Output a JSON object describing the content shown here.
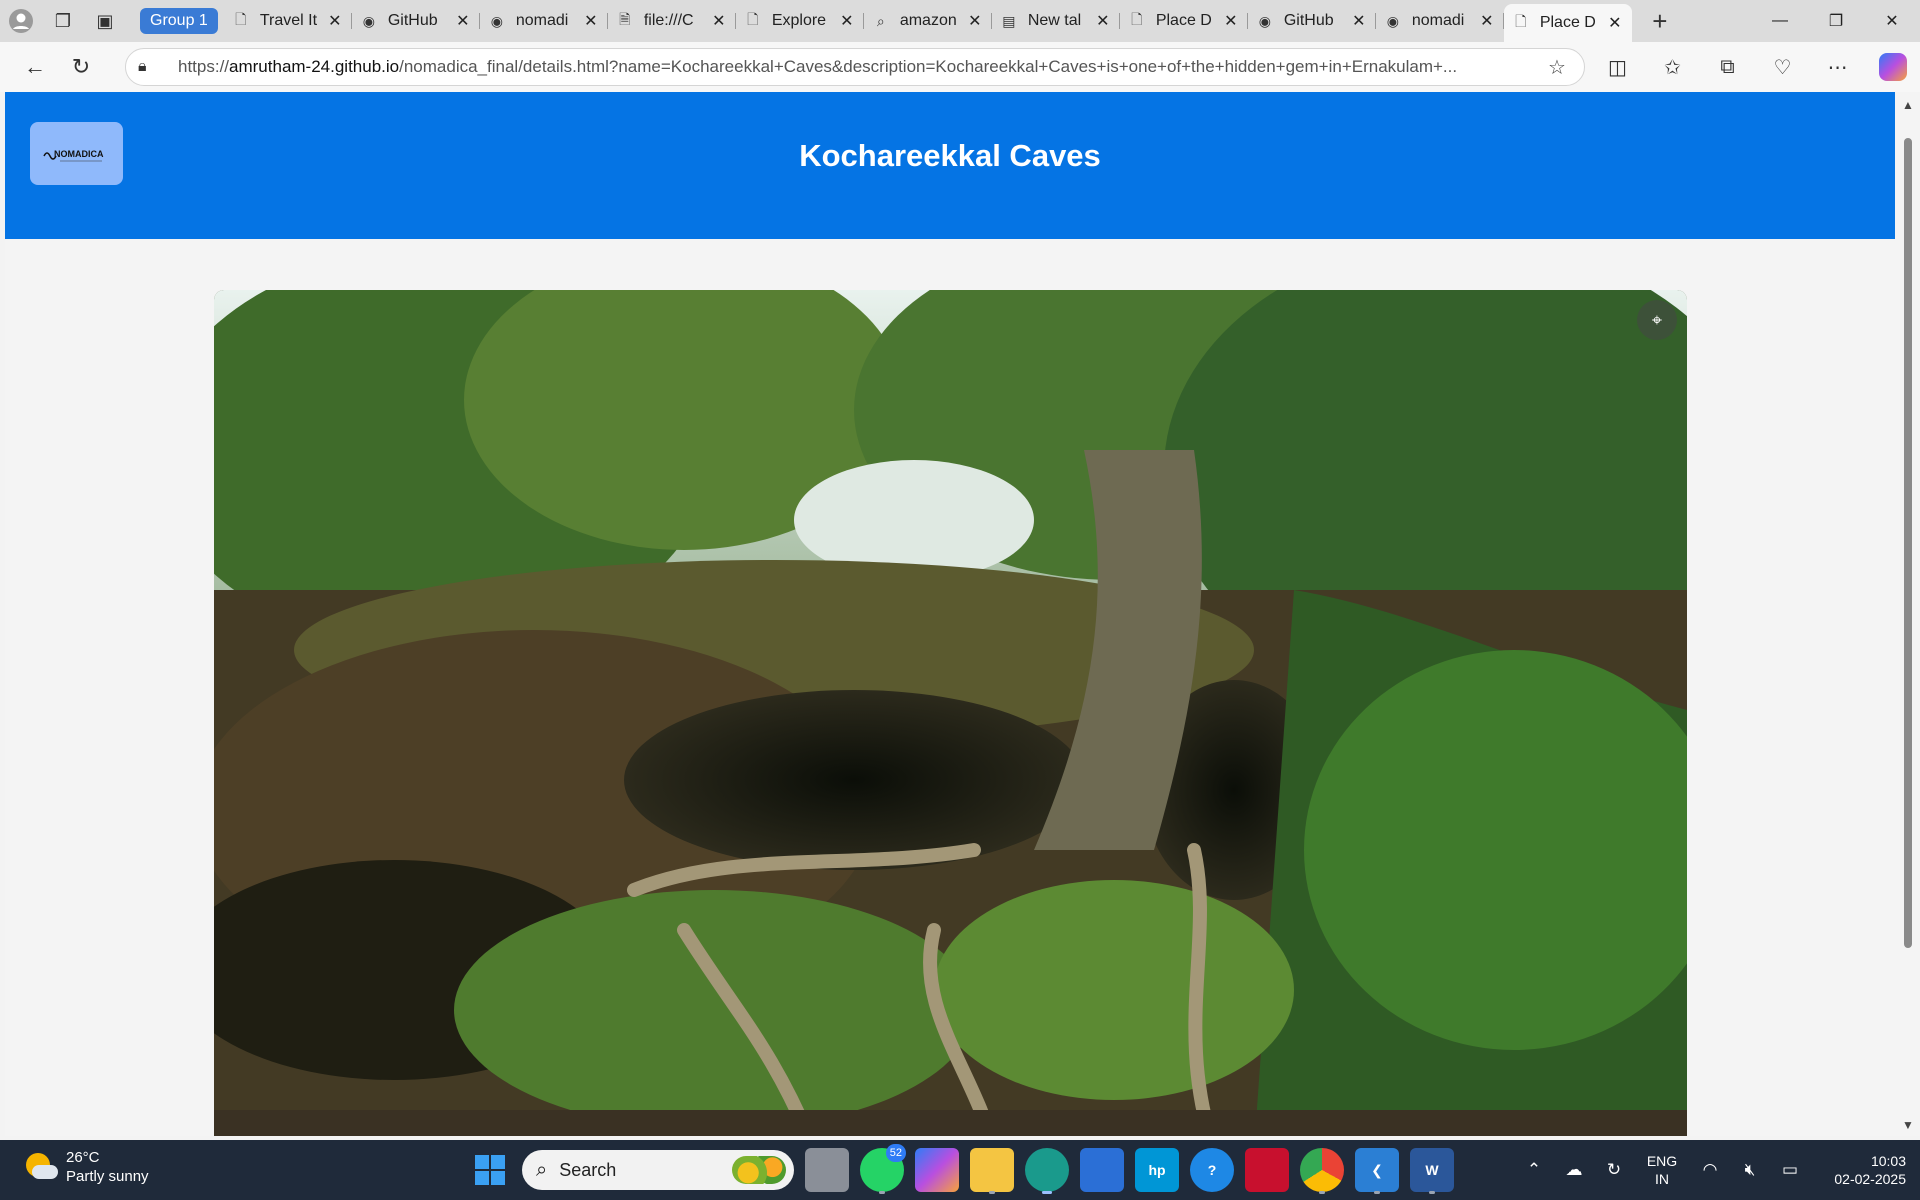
{
  "browser": {
    "group_label": "Group 1",
    "tabs": [
      {
        "title": "Travel It",
        "icon": "page-icon",
        "active": false
      },
      {
        "title": "GitHub",
        "icon": "github-icon",
        "active": false
      },
      {
        "title": "nomadi",
        "icon": "github-icon",
        "active": false
      },
      {
        "title": "file:///C",
        "icon": "file-icon",
        "active": false
      },
      {
        "title": "Explore",
        "icon": "page-icon",
        "active": false
      },
      {
        "title": "amazon",
        "icon": "search-icon",
        "active": false
      },
      {
        "title": "New tal",
        "icon": "newtab-icon",
        "active": false
      },
      {
        "title": "Place D",
        "icon": "page-icon",
        "active": false
      },
      {
        "title": "GitHub",
        "icon": "github-icon",
        "active": false
      },
      {
        "title": "nomadi",
        "icon": "github-icon",
        "active": false
      },
      {
        "title": "Place D",
        "icon": "page-icon",
        "active": true
      }
    ],
    "url_host": "amrutham-24.github.io",
    "url_prefix": "https://",
    "url_path": "/nomadica_final/details.html?name=Kochareekkal+Caves&description=Kochareekkal+Caves+is+one+of+the+hidden+gem+in+Ernakulam+..."
  },
  "site": {
    "logo_text": "NOMADICA",
    "title": "Kochareekkal Caves",
    "header_color": "#0574e4"
  },
  "taskbar": {
    "temperature": "26°C",
    "weather": "Partly sunny",
    "search_placeholder": "Search",
    "whatsapp_badge": "52",
    "lang_1": "ENG",
    "lang_2": "IN",
    "time": "10:03",
    "date": "02-02-2025"
  }
}
